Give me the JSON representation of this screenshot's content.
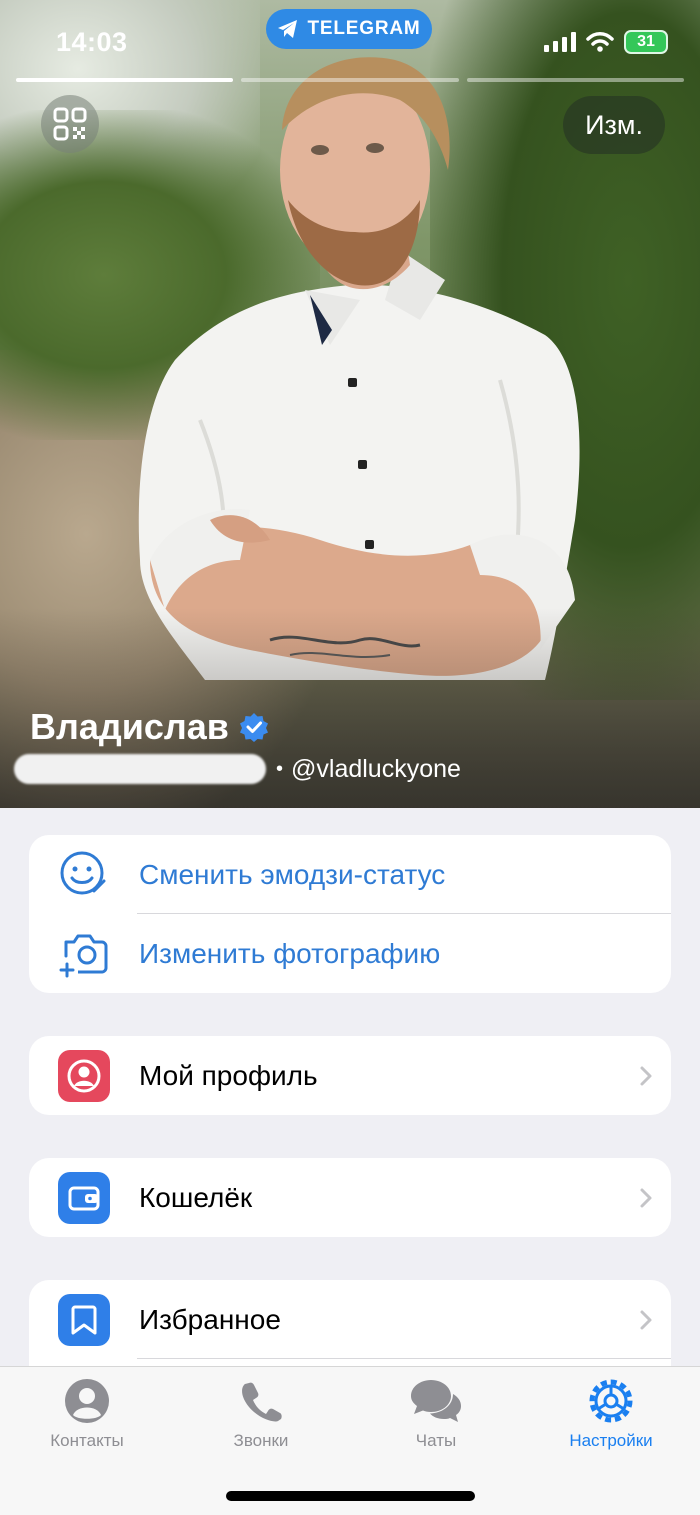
{
  "status_bar": {
    "time": "14:03",
    "app_badge": "TELEGRAM",
    "battery": "31"
  },
  "header": {
    "edit_label": "Изм."
  },
  "profile": {
    "name": "Владислав",
    "username": "@vladluckyone"
  },
  "actions": [
    {
      "label": "Сменить эмодзи-статус",
      "icon": "emoji-status-icon"
    },
    {
      "label": "Изменить фотографию",
      "icon": "camera-add-icon"
    }
  ],
  "menu": {
    "my_profile": {
      "label": "Мой профиль",
      "color": "#e5485d"
    },
    "wallet": {
      "label": "Кошелёк",
      "color": "#2f7fe8"
    },
    "saved": {
      "label": "Избранное",
      "color": "#2f7fe8"
    }
  },
  "tabs": [
    {
      "label": "Контакты",
      "icon": "person-icon"
    },
    {
      "label": "Звонки",
      "icon": "phone-icon"
    },
    {
      "label": "Чаты",
      "icon": "chat-bubbles-icon"
    },
    {
      "label": "Настройки",
      "icon": "gear-icon",
      "active": true
    }
  ],
  "colors": {
    "accent": "#1a7ff0",
    "link": "#2f7bd4",
    "telegram_pill": "#2f8ae5"
  }
}
